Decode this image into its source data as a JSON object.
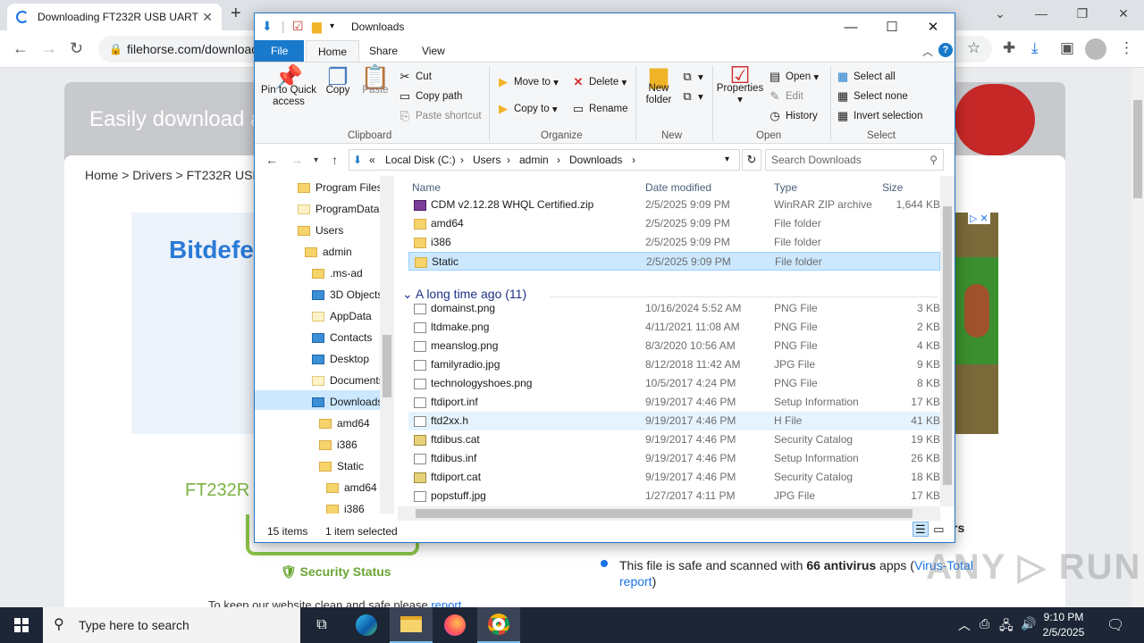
{
  "browser": {
    "tab_title": "Downloading FT232R USB UART",
    "url": "filehorse.com/download",
    "new_tab": "+"
  },
  "webpage": {
    "hero_text": "Easily download a",
    "breadcrumbs": "Home > Drivers > FT232R USB",
    "ad_brand": "Bitdefe",
    "ad_badges": "▷ ✕",
    "product_title": "FT232R",
    "security_status": "Security Status",
    "safe_prefix": "This file is safe and scanned with ",
    "safe_count": "66 antivirus",
    "safe_mid": " apps (",
    "safe_link": "Virus-Total report",
    "safe_end": ")",
    "keep_text": "To keep our website clean and safe please ",
    "keep_link": "report",
    "rs": "rs",
    "watermark": "ANY ▷ RUN"
  },
  "explorer": {
    "title": "Downloads",
    "tabs": [
      "File",
      "Home",
      "Share",
      "View"
    ],
    "ribbon": {
      "pin": "Pin to Quick access",
      "copy": "Copy",
      "paste": "Paste",
      "cut": "Cut",
      "copy_path": "Copy path",
      "paste_shortcut": "Paste shortcut",
      "clipboard": "Clipboard",
      "move_to": "Move to",
      "copy_to": "Copy to",
      "delete": "Delete",
      "rename": "Rename",
      "organize": "Organize",
      "new_folder": "New folder",
      "new": "New",
      "properties": "Properties",
      "open": "Open",
      "edit": "Edit",
      "history": "History",
      "open_group": "Open",
      "select_all": "Select all",
      "select_none": "Select none",
      "invert_selection": "Invert selection",
      "select": "Select"
    },
    "address": {
      "prefix": "«",
      "parts": [
        "Local Disk (C:)",
        "Users",
        "admin",
        "Downloads"
      ],
      "search_placeholder": "Search Downloads"
    },
    "nav": [
      "Program Files",
      "ProgramData",
      "Users",
      "admin",
      ".ms-ad",
      "3D Objects",
      "AppData",
      "Contacts",
      "Desktop",
      "Documents",
      "Downloads",
      "amd64",
      "i386",
      "Static",
      "amd64",
      "i386"
    ],
    "columns": {
      "name": "Name",
      "date": "Date modified",
      "type": "Type",
      "size": "Size"
    },
    "group_label": "A long time ago (11)",
    "files": [
      {
        "name": "CDM v2.12.28 WHQL Certified.zip",
        "date": "2/5/2025 9:09 PM",
        "type": "WinRAR ZIP archive",
        "size": "1,644 KB",
        "icon": "zip"
      },
      {
        "name": "amd64",
        "date": "2/5/2025 9:09 PM",
        "type": "File folder",
        "size": "",
        "icon": "folder"
      },
      {
        "name": "i386",
        "date": "2/5/2025 9:09 PM",
        "type": "File folder",
        "size": "",
        "icon": "folder"
      },
      {
        "name": "Static",
        "date": "2/5/2025 9:09 PM",
        "type": "File folder",
        "size": "",
        "icon": "folder"
      },
      {
        "name": "domainst.png",
        "date": "10/16/2024 5:52 AM",
        "type": "PNG File",
        "size": "3 KB",
        "icon": "file"
      },
      {
        "name": "ltdmake.png",
        "date": "4/11/2021 11:08 AM",
        "type": "PNG File",
        "size": "2 KB",
        "icon": "file"
      },
      {
        "name": "meanslog.png",
        "date": "8/3/2020 10:56 AM",
        "type": "PNG File",
        "size": "4 KB",
        "icon": "file"
      },
      {
        "name": "familyradio.jpg",
        "date": "8/12/2018 11:42 AM",
        "type": "JPG File",
        "size": "9 KB",
        "icon": "file"
      },
      {
        "name": "technologyshoes.png",
        "date": "10/5/2017 4:24 PM",
        "type": "PNG File",
        "size": "8 KB",
        "icon": "file"
      },
      {
        "name": "ftdiport.inf",
        "date": "9/19/2017 4:46 PM",
        "type": "Setup Information",
        "size": "17 KB",
        "icon": "file"
      },
      {
        "name": "ftd2xx.h",
        "date": "9/19/2017 4:46 PM",
        "type": "H File",
        "size": "41 KB",
        "icon": "file"
      },
      {
        "name": "ftdibus.cat",
        "date": "9/19/2017 4:46 PM",
        "type": "Security Catalog",
        "size": "19 KB",
        "icon": "cat"
      },
      {
        "name": "ftdibus.inf",
        "date": "9/19/2017 4:46 PM",
        "type": "Setup Information",
        "size": "26 KB",
        "icon": "file"
      },
      {
        "name": "ftdiport.cat",
        "date": "9/19/2017 4:46 PM",
        "type": "Security Catalog",
        "size": "18 KB",
        "icon": "cat"
      },
      {
        "name": "popstuff.jpg",
        "date": "1/27/2017 4:11 PM",
        "type": "JPG File",
        "size": "17 KB",
        "icon": "file"
      }
    ],
    "status_items": "15 items",
    "status_selected": "1 item selected"
  },
  "taskbar": {
    "search_placeholder": "Type here to search",
    "time": "9:10 PM",
    "date": "2/5/2025"
  }
}
